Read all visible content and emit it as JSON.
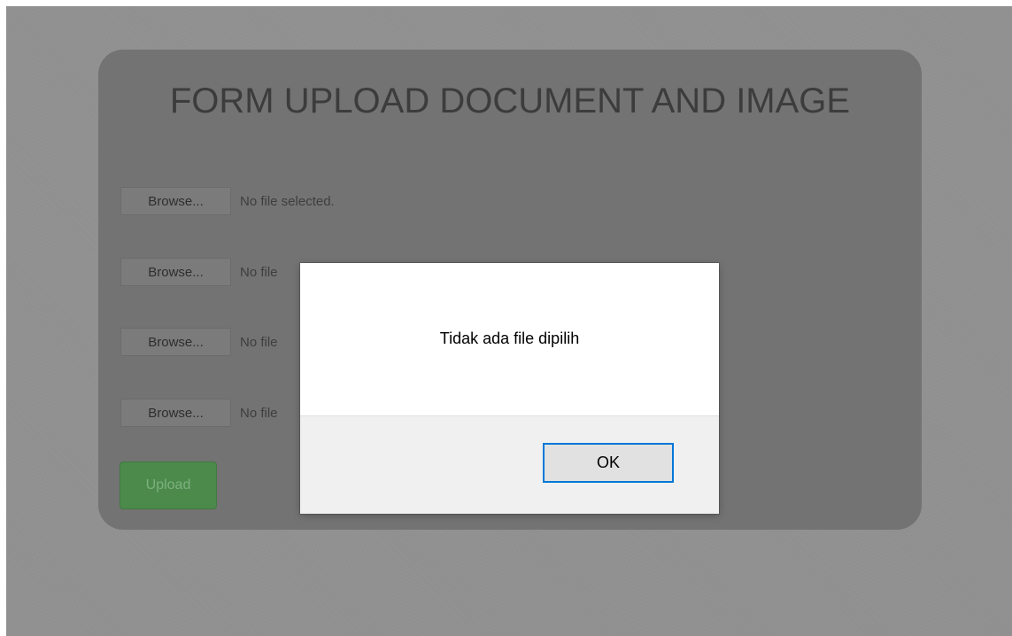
{
  "form": {
    "title": "FORM UPLOAD DOCUMENT AND IMAGE",
    "file_inputs": [
      {
        "button_label": "Browse...",
        "status": "No file selected."
      },
      {
        "button_label": "Browse...",
        "status": "No file"
      },
      {
        "button_label": "Browse...",
        "status": "No file"
      },
      {
        "button_label": "Browse...",
        "status": "No file"
      }
    ],
    "upload_label": "Upload"
  },
  "dialog": {
    "message": "Tidak ada file dipilih",
    "ok_label": "OK"
  },
  "colors": {
    "overlay": "#8f8f8f",
    "card": "#737373",
    "upload_button": "#4b8a4b",
    "ok_focus_border": "#0078d7"
  }
}
